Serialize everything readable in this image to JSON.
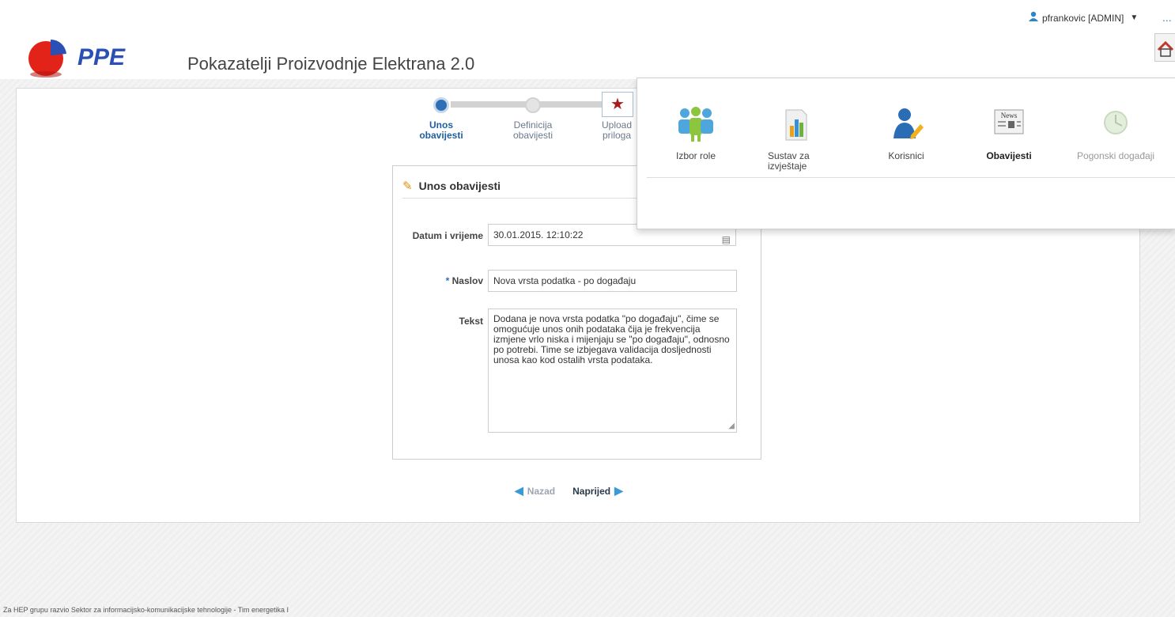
{
  "header": {
    "app_title": "Pokazatelji Proizvodnje Elektrana 2.0",
    "logo_text": "PPE",
    "user_label": "pfrankovic [ADMIN]",
    "more_dots": "..."
  },
  "wizard": {
    "steps": [
      {
        "label_line1": "Unos",
        "label_line2": "obavijesti",
        "state": "active"
      },
      {
        "label_line1": "Definicija",
        "label_line2": "obavijesti",
        "state": "inactive"
      },
      {
        "label_line1": "Upload",
        "label_line2": "priloga",
        "state": "inactive"
      }
    ]
  },
  "form": {
    "title": "Unos obavijesti",
    "datum_label": "Datum i vrijeme",
    "datum_value": "30.01.2015. 12:10:22",
    "naslov_required": "*",
    "naslov_label": "Naslov",
    "naslov_value": "Nova vrsta podatka - po događaju",
    "tekst_label": "Tekst",
    "tekst_value": "Dodana je nova vrsta podatka \"po događaju\", čime se omogućuje unos onih podataka čija je frekvencija izmjene vrlo niska i mijenjaju se \"po događaju\", odnosno po potrebi. Time se izbjegava validacija dosljednosti unosa kao kod ostalih vrsta podataka."
  },
  "nav": {
    "back_label": "Nazad",
    "next_label": "Naprijed"
  },
  "app_menu": {
    "items": [
      {
        "label": "Izbor role",
        "icon": "users-group-icon",
        "state": "normal"
      },
      {
        "label": "Sustav za izvještaje",
        "icon": "report-chart-icon",
        "state": "normal"
      },
      {
        "label": "Korisnici",
        "icon": "user-edit-icon",
        "state": "normal"
      },
      {
        "label": "Obavijesti",
        "icon": "news-icon",
        "state": "current"
      },
      {
        "label": "Pogonski događaji",
        "icon": "clock-event-icon",
        "state": "disabled"
      }
    ]
  },
  "colors": {
    "accent_blue": "#2c6fb7",
    "star_red": "#a81c1c",
    "arrow_blue": "#3b9ad6"
  },
  "footer": {
    "text": "Za HEP grupu razvio Sektor za informacijsko-komunikacijske tehnologije - Tim energetika I"
  }
}
